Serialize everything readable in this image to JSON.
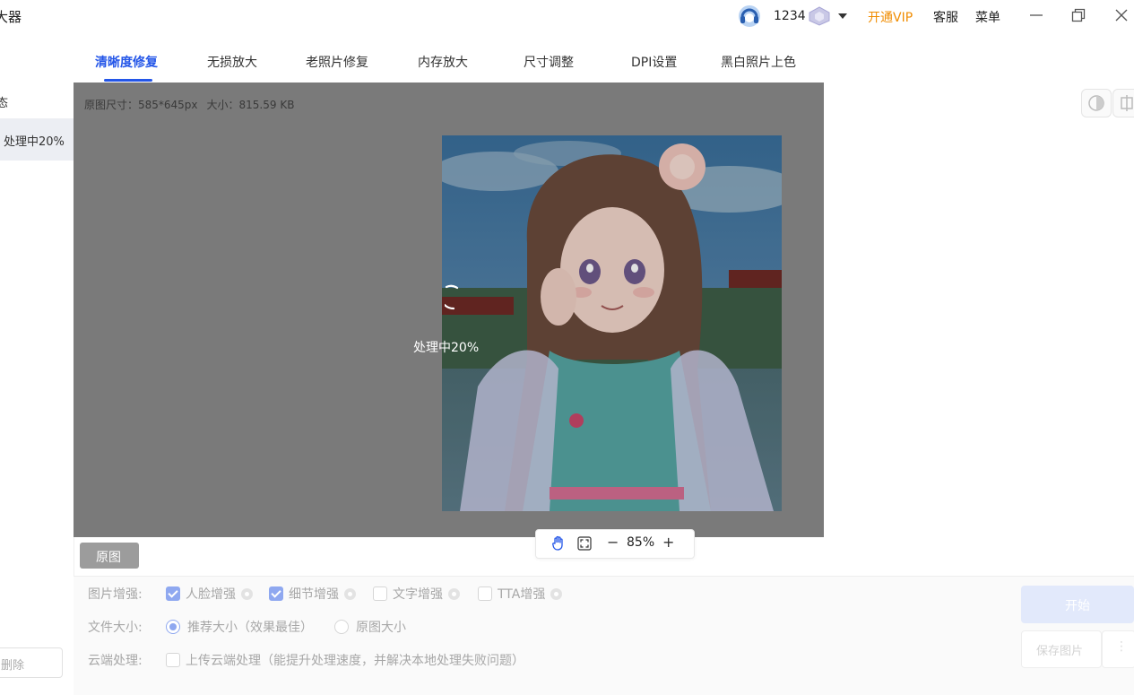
{
  "app": {
    "title_fragment": "大器"
  },
  "user": {
    "id": "1234",
    "vip_link": "开通VIP",
    "service": "客服",
    "menu": "菜单"
  },
  "tabs": [
    {
      "label": "清晰度修复",
      "active": true
    },
    {
      "label": "无损放大"
    },
    {
      "label": "老照片修复"
    },
    {
      "label": "内存放大"
    },
    {
      "label": "尺寸调整"
    },
    {
      "label": "DPI设置"
    },
    {
      "label": "黑白照片上色"
    }
  ],
  "sidebar": {
    "status_header": "态",
    "file_item": "处理中20%",
    "delete_label": "删除"
  },
  "preview": {
    "size_label": "原图尺寸：585*645px",
    "file_size_label": "大小：815.59 KB",
    "processing_text": "处理中20%",
    "progress_percent": 20
  },
  "zoom": {
    "level": "85%",
    "minus": "−",
    "plus": "+"
  },
  "original_button": "原图",
  "settings": {
    "enhance_label": "图片增强:",
    "enhance_options": [
      {
        "label": "人脸增强",
        "checked": true
      },
      {
        "label": "细节增强",
        "checked": true
      },
      {
        "label": "文字增强",
        "checked": false
      },
      {
        "label": "TTA增强",
        "checked": false
      }
    ],
    "size_label": "文件大小:",
    "size_options": [
      {
        "label": "推荐大小（效果最佳）",
        "selected": true
      },
      {
        "label": "原图大小",
        "selected": false
      }
    ],
    "cloud_label": "云端处理:",
    "cloud_option": {
      "label": "上传云端处理（能提升处理速度，并解决本地处理失败问题）",
      "checked": false
    }
  },
  "actions": {
    "start": "开始",
    "save": "保存图片",
    "more": "⋮"
  },
  "colors": {
    "accent": "#2456e8",
    "vip": "#f08c00",
    "overlay": "#7a7a7a"
  }
}
